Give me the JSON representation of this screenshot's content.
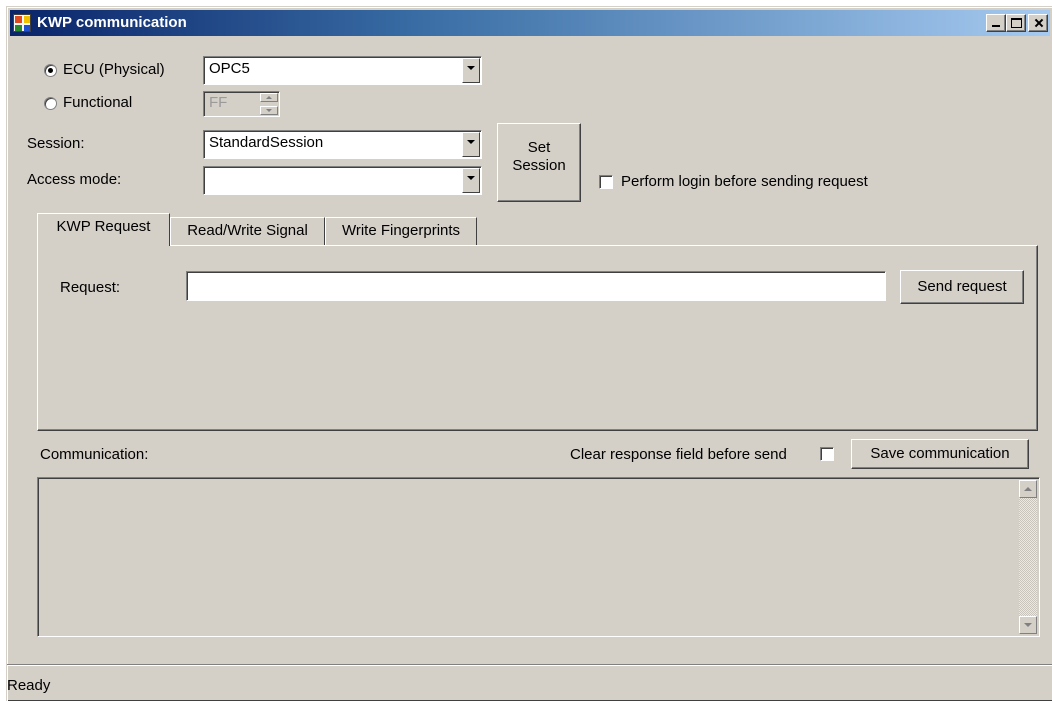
{
  "window": {
    "title": "KWP communication",
    "title_bar_gradient": [
      "#0a246a",
      "#a6caf0"
    ],
    "face_color": "#d4d0c8"
  },
  "target": {
    "ecu_label": "ECU (Physical)",
    "ecu_selected": true,
    "ecu_value": "OPC5",
    "functional_label": "Functional",
    "functional_selected": false,
    "functional_value": "FF"
  },
  "session": {
    "session_label": "Session:",
    "session_value": "StandardSession",
    "access_label": "Access mode:",
    "access_value": "",
    "set_session_line1": "Set",
    "set_session_line2": "Session",
    "login_label": "Perform login before sending request",
    "login_checked": false
  },
  "tabs": [
    {
      "label": "KWP Request",
      "active": true
    },
    {
      "label": "Read/Write Signal",
      "active": false
    },
    {
      "label": "Write Fingerprints",
      "active": false
    }
  ],
  "request": {
    "label": "Request:",
    "value": "",
    "send_label": "Send request"
  },
  "communication": {
    "label": "Communication:",
    "clear_label": "Clear response field before send",
    "clear_checked": false,
    "save_label": "Save communication",
    "content": ""
  },
  "status": {
    "text": "Ready"
  }
}
